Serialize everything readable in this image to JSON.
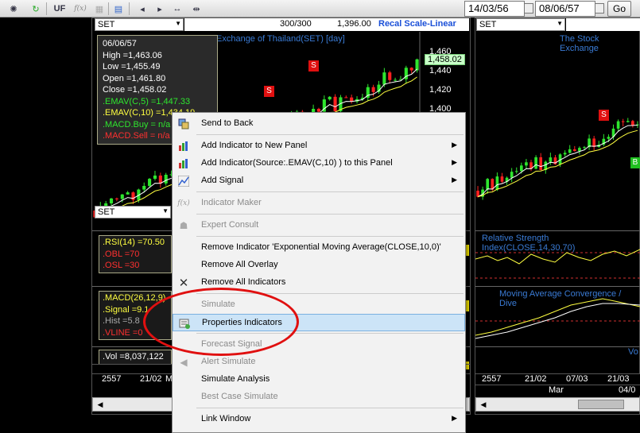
{
  "toolbar": {
    "uf_label": "UF",
    "fx_label": "f(x)",
    "start_date": "14/03/56",
    "end_date": "08/06/57",
    "go_label": "Go"
  },
  "left_chart": {
    "symbol": "SET",
    "count": "300/300",
    "price": "1,396.00",
    "scale_label": "Recal Scale-Linear",
    "title": "Exchange of Thailand(SET) [day]",
    "yticks": [
      "1,460",
      "1,440",
      "1,420",
      "1,400"
    ],
    "current_price": "1,458.02",
    "signal_label": "S",
    "info": {
      "date": "06/06/57",
      "high": "High  =1,463.06",
      "low": "Low   =1,455.49",
      "open": "Open  =1,461.80",
      "close": "Close  =1,458.02",
      "emav5": ".EMAV(C,5)   =1,447.33",
      "emav10": ".EMAV(C,10)  =1,434.19",
      "macd_buy": ".MACD.Buy  = n/a",
      "macd_sell": ".MACD.Sell  = n/a"
    },
    "rsi": {
      "line1": ".RSI(14)   =70.50",
      "line2": ".OBL   =70",
      "line3": ".OSL   =30"
    },
    "macd": {
      "line1": ".MACD(26,12,9)",
      "line2": ".Signal  =9.1",
      "line3": ".Hist   =5.8",
      "line4": ".VLINE  =0"
    },
    "volume": ".Vol   =8,037,122",
    "timeline": [
      "2557",
      "21/02",
      "M"
    ]
  },
  "right_chart": {
    "symbol": "SET",
    "title": "The Stock Exchange",
    "rsi_title": "Relative Strength Index(CLOSE,14,30,70)",
    "macd_title": "Moving Average Convergence / Dive",
    "vol_title": "Vo",
    "signal_label": "S",
    "buy_label": "B",
    "timeline": [
      "2557",
      "21/02",
      "07/03",
      "21/03",
      "Mar",
      "04/0"
    ]
  },
  "context_menu": {
    "items": [
      {
        "label": "Send to Back",
        "icon": "layers-icon",
        "disabled": false,
        "submenu": false
      },
      {
        "label": "Add Indicator to New Panel",
        "icon": "bar-chart-icon",
        "disabled": false,
        "submenu": true
      },
      {
        "label": "Add Indicator(Source:.EMAV(C,10) ) to this Panel",
        "icon": "bar-chart-icon",
        "disabled": false,
        "submenu": true
      },
      {
        "label": "Add Signal",
        "icon": "signal-chart-icon",
        "disabled": false,
        "submenu": true
      },
      {
        "label": "Indicator Maker",
        "icon": "function-icon",
        "disabled": true,
        "submenu": false
      },
      {
        "label": "Expert Consult",
        "icon": "person-icon",
        "disabled": true,
        "submenu": false
      },
      {
        "label": "Remove Indicator 'Exponential Moving Average(CLOSE,10,0)'",
        "icon": "",
        "disabled": false,
        "submenu": false
      },
      {
        "label": "Remove All Overlay",
        "icon": "",
        "disabled": false,
        "submenu": false
      },
      {
        "label": "Remove All Indicators",
        "icon": "close-icon",
        "disabled": false,
        "submenu": false
      },
      {
        "label": "Simulate",
        "icon": "",
        "disabled": true,
        "submenu": false
      },
      {
        "label": "Properties Indicators",
        "icon": "properties-icon",
        "disabled": false,
        "submenu": false
      },
      {
        "label": "Forecast Signal",
        "icon": "",
        "disabled": true,
        "submenu": false
      },
      {
        "label": "Alert Simulate",
        "icon": "speaker-icon",
        "disabled": true,
        "submenu": false
      },
      {
        "label": "Simulate Analysis",
        "icon": "",
        "disabled": false,
        "submenu": false
      },
      {
        "label": "Best Case Simulate",
        "icon": "",
        "disabled": true,
        "submenu": false
      },
      {
        "label": "Link Window",
        "icon": "",
        "disabled": false,
        "submenu": true
      }
    ]
  },
  "colors": {
    "candle_up": "#2ee62e",
    "candle_down": "#ff2020",
    "ema_fast": "#ffffff",
    "ema_slow": "#ffff40",
    "highlight": "#cce4f7",
    "annotation": "#e01010"
  }
}
